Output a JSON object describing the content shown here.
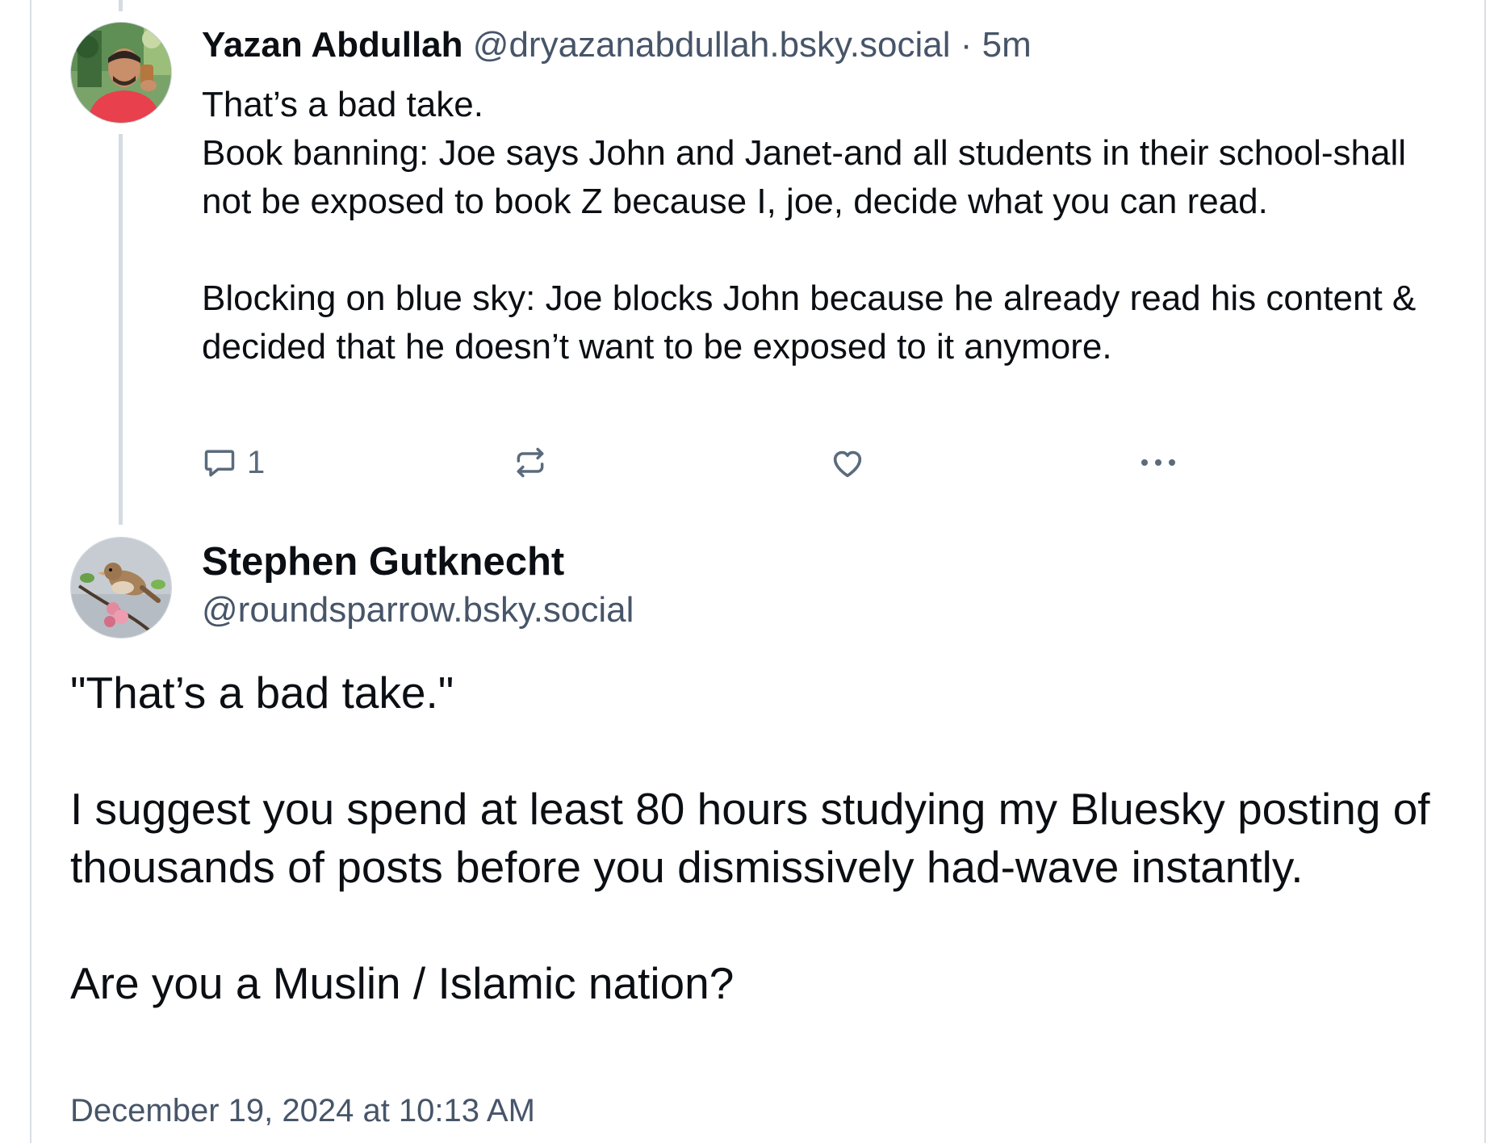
{
  "parent_post": {
    "author_name": "Yazan Abdullah",
    "author_handle": "@dryazanabdullah.bsky.social",
    "separator": "·",
    "time_ago": "5m",
    "avatar_icon": "user-avatar-photo",
    "lines": [
      "That’s a bad take.",
      "Book banning: Joe says John and Janet-and all students in their school-shall not be exposed to book Z because I, joe, decide what you can read.",
      "",
      "Blocking on blue sky: Joe blocks John because he already read his content & decided that he doesn’t want to be exposed to it anymore."
    ],
    "actions": {
      "reply_icon": "reply-icon",
      "reply_count": "1",
      "repost_icon": "repost-icon",
      "like_icon": "heart-icon",
      "more_icon": "more-options-icon"
    }
  },
  "focused_post": {
    "author_name": "Stephen Gutknecht",
    "author_handle": "@roundsparrow.bsky.social",
    "avatar_icon": "sparrow-avatar-photo",
    "paragraphs": [
      "\"That’s a bad take.\"",
      "",
      "I suggest you spend at least 80 hours studying my Bluesky posting of thousands of posts before you dismissively had-wave instantly.",
      "",
      "Are you a Muslin / Islamic nation?"
    ],
    "timestamp": "December 19, 2024 at 10:13 AM"
  },
  "colors": {
    "text_primary": "#0b0f14",
    "text_secondary": "#475569",
    "icon_gray": "#5b6b7c",
    "thread_line": "#d4dbe3"
  }
}
